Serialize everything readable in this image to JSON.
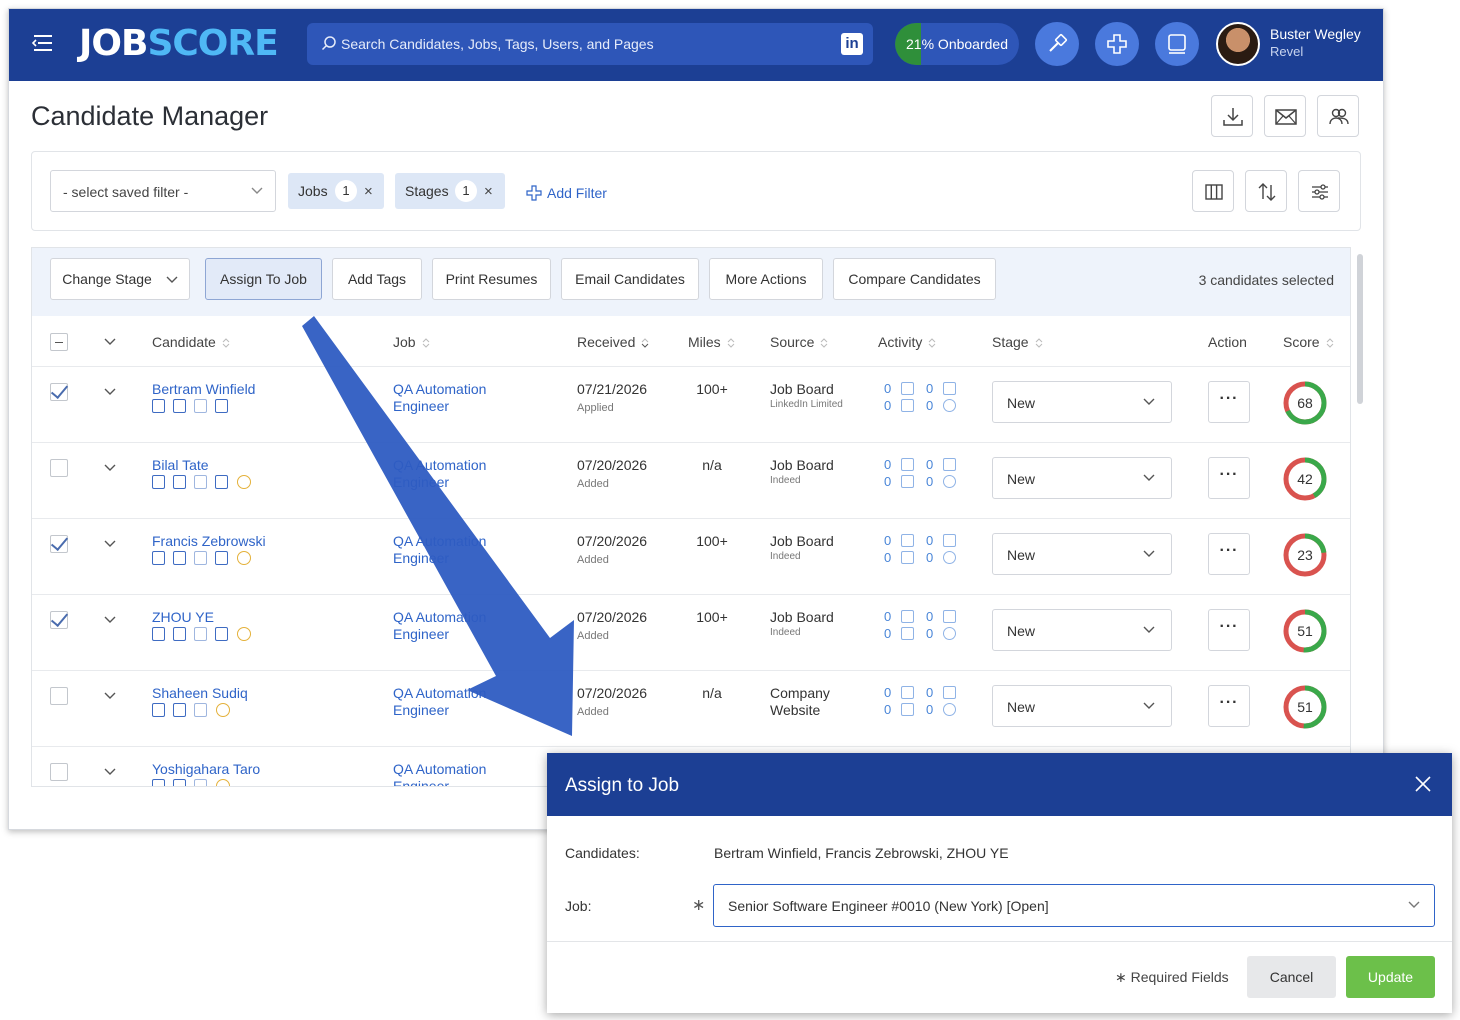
{
  "topbar": {
    "logo_part1": "JOB",
    "logo_part2": "SCORE",
    "search_placeholder": "Search Candidates, Jobs, Tags, Users, and Pages",
    "linkedin_label": "in",
    "onboarded_label": "21% Onboarded",
    "onboarded_progress": 0.21,
    "user_name": "Buster Wegley",
    "user_org": "Revel"
  },
  "page": {
    "title": "Candidate Manager"
  },
  "filters": {
    "saved_filter": "- select saved filter -",
    "chips": [
      {
        "label": "Jobs",
        "count": "1",
        "remove": "×"
      },
      {
        "label": "Stages",
        "count": "1",
        "remove": "×"
      }
    ],
    "add_filter": "Add Filter"
  },
  "actions": {
    "buttons": [
      "Change Stage",
      "Assign To Job",
      "Add Tags",
      "Print Resumes",
      "Email Candidates",
      "More Actions",
      "Compare Candidates"
    ],
    "selected_count": "3 candidates selected"
  },
  "table": {
    "headers": {
      "candidate": "Candidate",
      "job": "Job",
      "received": "Received",
      "miles": "Miles",
      "source": "Source",
      "activity": "Activity",
      "stage": "Stage",
      "action": "Action",
      "score": "Score"
    },
    "rows": [
      {
        "name": "Bertram Winfield",
        "job1": "QA Automation",
        "job2": "Engineer",
        "date": "07/21/2026",
        "date_sub": "Applied",
        "miles": "100+",
        "source": "Job Board",
        "source_sub": "LinkedIn Limited",
        "a1": "0",
        "a2": "0",
        "a3": "0",
        "a4": "0",
        "stage": "New",
        "dots": "···",
        "score": "68",
        "score_value": 68,
        "checked": true
      },
      {
        "name": "Bilal Tate",
        "job1": "QA Automation",
        "job2": "Engineer",
        "date": "07/20/2026",
        "date_sub": "Added",
        "miles": "n/a",
        "source": "Job Board",
        "source_sub": "Indeed",
        "a1": "0",
        "a2": "0",
        "a3": "0",
        "a4": "0",
        "stage": "New",
        "dots": "···",
        "score": "42",
        "score_value": 42,
        "checked": false
      },
      {
        "name": "Francis Zebrowski",
        "job1": "QA Automation",
        "job2": "Engineer",
        "date": "07/20/2026",
        "date_sub": "Added",
        "miles": "100+",
        "source": "Job Board",
        "source_sub": "Indeed",
        "a1": "0",
        "a2": "0",
        "a3": "0",
        "a4": "0",
        "stage": "New",
        "dots": "···",
        "score": "23",
        "score_value": 23,
        "checked": true
      },
      {
        "name": "ZHOU YE",
        "job1": "QA Automation",
        "job2": "Engineer",
        "date": "07/20/2026",
        "date_sub": "Added",
        "miles": "100+",
        "source": "Job Board",
        "source_sub": "Indeed",
        "a1": "0",
        "a2": "0",
        "a3": "0",
        "a4": "0",
        "stage": "New",
        "dots": "···",
        "score": "51",
        "score_value": 51,
        "checked": true
      },
      {
        "name": "Shaheen Sudiq",
        "job1": "QA Automation",
        "job2": "Engineer",
        "date": "07/20/2026",
        "date_sub": "Added",
        "miles": "n/a",
        "source": "Company",
        "source2": "Website",
        "source_sub": "",
        "a1": "0",
        "a2": "0",
        "a3": "0",
        "a4": "0",
        "stage": "New",
        "dots": "···",
        "score": "51",
        "score_value": 51,
        "checked": false
      },
      {
        "name": "Yoshigahara Taro",
        "job1": "QA Automation",
        "job2": "Engineer",
        "checked": false
      }
    ]
  },
  "modal": {
    "title": "Assign to Job",
    "close": "×",
    "candidates_label": "Candidates:",
    "candidates_value": "Bertram Winfield, Francis Zebrowski, ZHOU YE",
    "job_label": "Job:",
    "required_mark": "∗",
    "job_value": "Senior Software Engineer #0010 (New York) [Open]",
    "required_note": "∗ Required Fields",
    "cancel": "Cancel",
    "update": "Update"
  },
  "colors": {
    "brand": "#1c3f94",
    "link": "#2f64c8",
    "score_green": "#3aa84a",
    "score_red": "#d9534f",
    "update_green": "#6cc04a"
  }
}
